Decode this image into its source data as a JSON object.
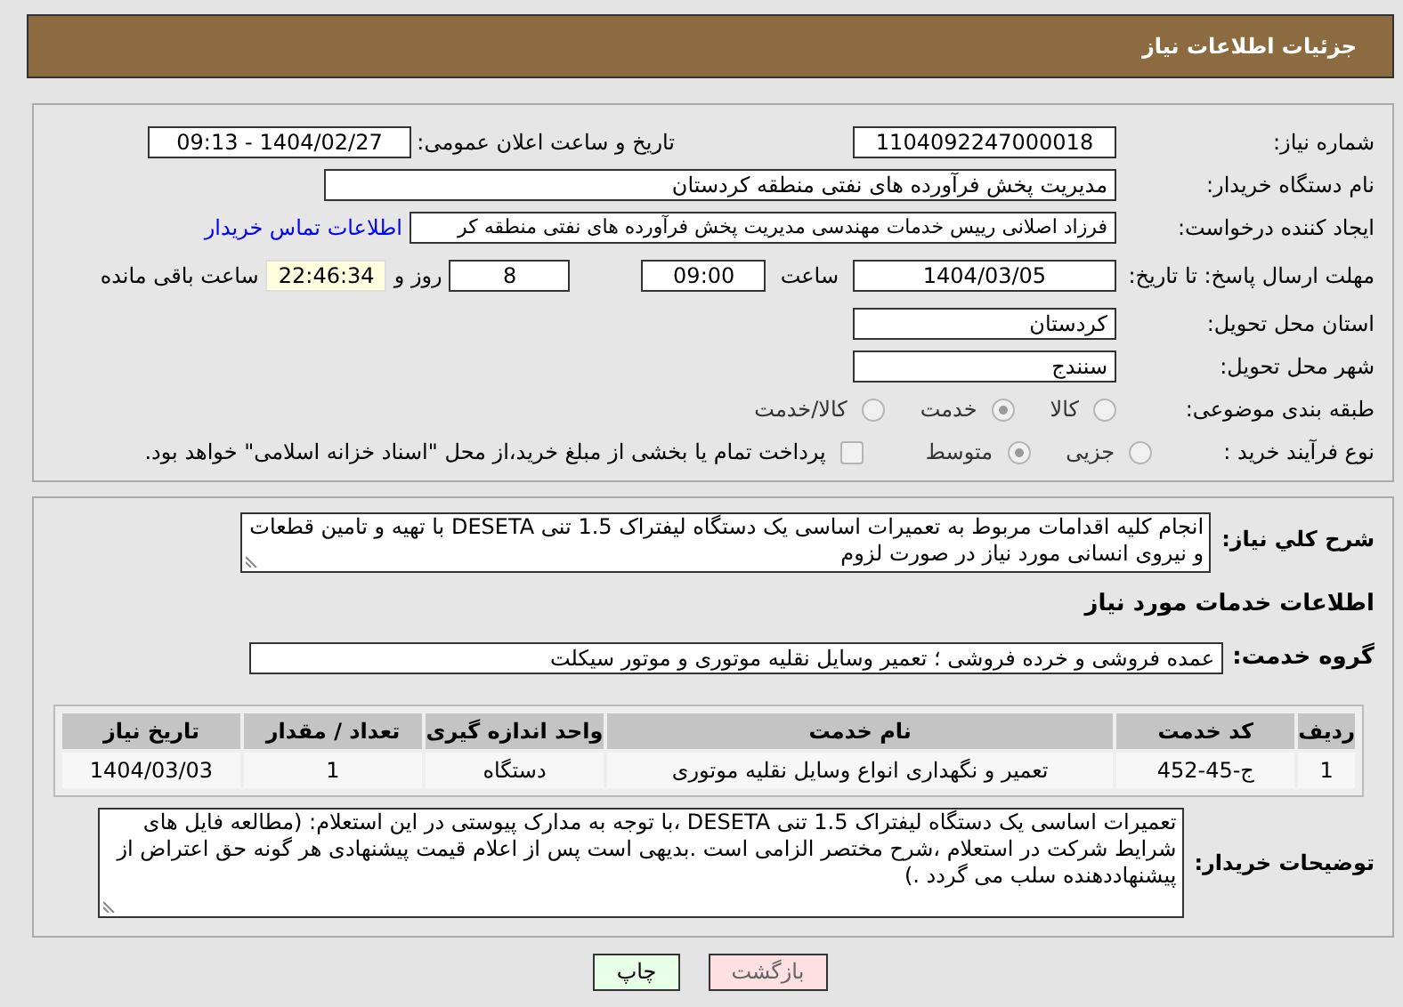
{
  "header": {
    "title": "جزئیات اطلاعات نیاز"
  },
  "need_number": {
    "label": "شماره نیاز:",
    "value": "1104092247000018"
  },
  "announce": {
    "label": "تاریخ و ساعت اعلان عمومی:",
    "value": "1404/02/27 - 09:13"
  },
  "buyer_org": {
    "label": "نام دستگاه خریدار:",
    "value": "مدیریت پخش فرآورده های نفتی منطقه کردستان"
  },
  "creator": {
    "label": "ایجاد کننده درخواست:",
    "value": "فرزاد اصلانی رییس خدمات مهندسی مدیریت پخش فرآورده های نفتی منطقه کر",
    "link": "اطلاعات تماس خریدار"
  },
  "deadline": {
    "label": "مهلت ارسال پاسخ: تا تاریخ:",
    "date": "1404/03/05",
    "time_label": "ساعت",
    "time": "09:00",
    "days": "8",
    "days_label": "روز و",
    "remaining": "22:46:34",
    "remaining_label": "ساعت باقی مانده"
  },
  "province": {
    "label": "استان محل تحویل:",
    "value": "کردستان"
  },
  "city": {
    "label": "شهر محل تحویل:",
    "value": "سنندج"
  },
  "category": {
    "label": "طبقه بندی موضوعی:",
    "options": [
      {
        "label": "کالا",
        "selected": false
      },
      {
        "label": "خدمت",
        "selected": true
      },
      {
        "label": "کالا/خدمت",
        "selected": false
      }
    ]
  },
  "process": {
    "label": "نوع فرآیند خرید :",
    "options": [
      {
        "label": "جزیی",
        "selected": false
      },
      {
        "label": "متوسط",
        "selected": true
      }
    ],
    "payment": {
      "checked": false,
      "text": "پرداخت تمام یا بخشی از مبلغ خرید،از محل \"اسناد خزانه اسلامی\" خواهد بود."
    }
  },
  "description": {
    "label": "شرح کلي نياز:",
    "value": "انجام کلیه اقدامات مربوط به تعمیرات اساسی یک دستگاه لیفتراک 1.5 تنی DESETA با تهیه و تامین قطعات و نیروی انسانی مورد نیاز در صورت لزوم"
  },
  "services_heading": "اطلاعات خدمات مورد نیاز",
  "service_group": {
    "label": "گروه خدمت:",
    "value": "عمده فروشی و خرده فروشی ؛ تعمیر وسایل نقلیه موتوری و موتور سیکلت"
  },
  "table": {
    "columns": [
      "ردیف",
      "کد خدمت",
      "نام خدمت",
      "واحد اندازه گیری",
      "تعداد / مقدار",
      "تاریخ نیاز"
    ],
    "rows": [
      [
        "1",
        "ج-45-452",
        "تعمیر و نگهداری انواع وسایل نقلیه موتوری",
        "دستگاه",
        "1",
        "1404/03/03"
      ]
    ]
  },
  "buyer_notes": {
    "label": "توضیحات خریدار:",
    "value": "تعمیرات اساسی یک دستگاه لیفتراک 1.5 تنی DESETA ،با توجه به مدارک پیوستی در این استعلام: (مطالعه فایل های شرایط شرکت در استعلام ،شرح مختصر  الزامی است .بدیهی است پس از اعلام قیمت پیشنهادی هر گونه حق اعتراض از پیشنهاددهنده سلب می گردد .)"
  },
  "buttons": [
    {
      "label": "بازگشت",
      "kind": "back"
    },
    {
      "label": "چاپ",
      "kind": "print"
    }
  ]
}
